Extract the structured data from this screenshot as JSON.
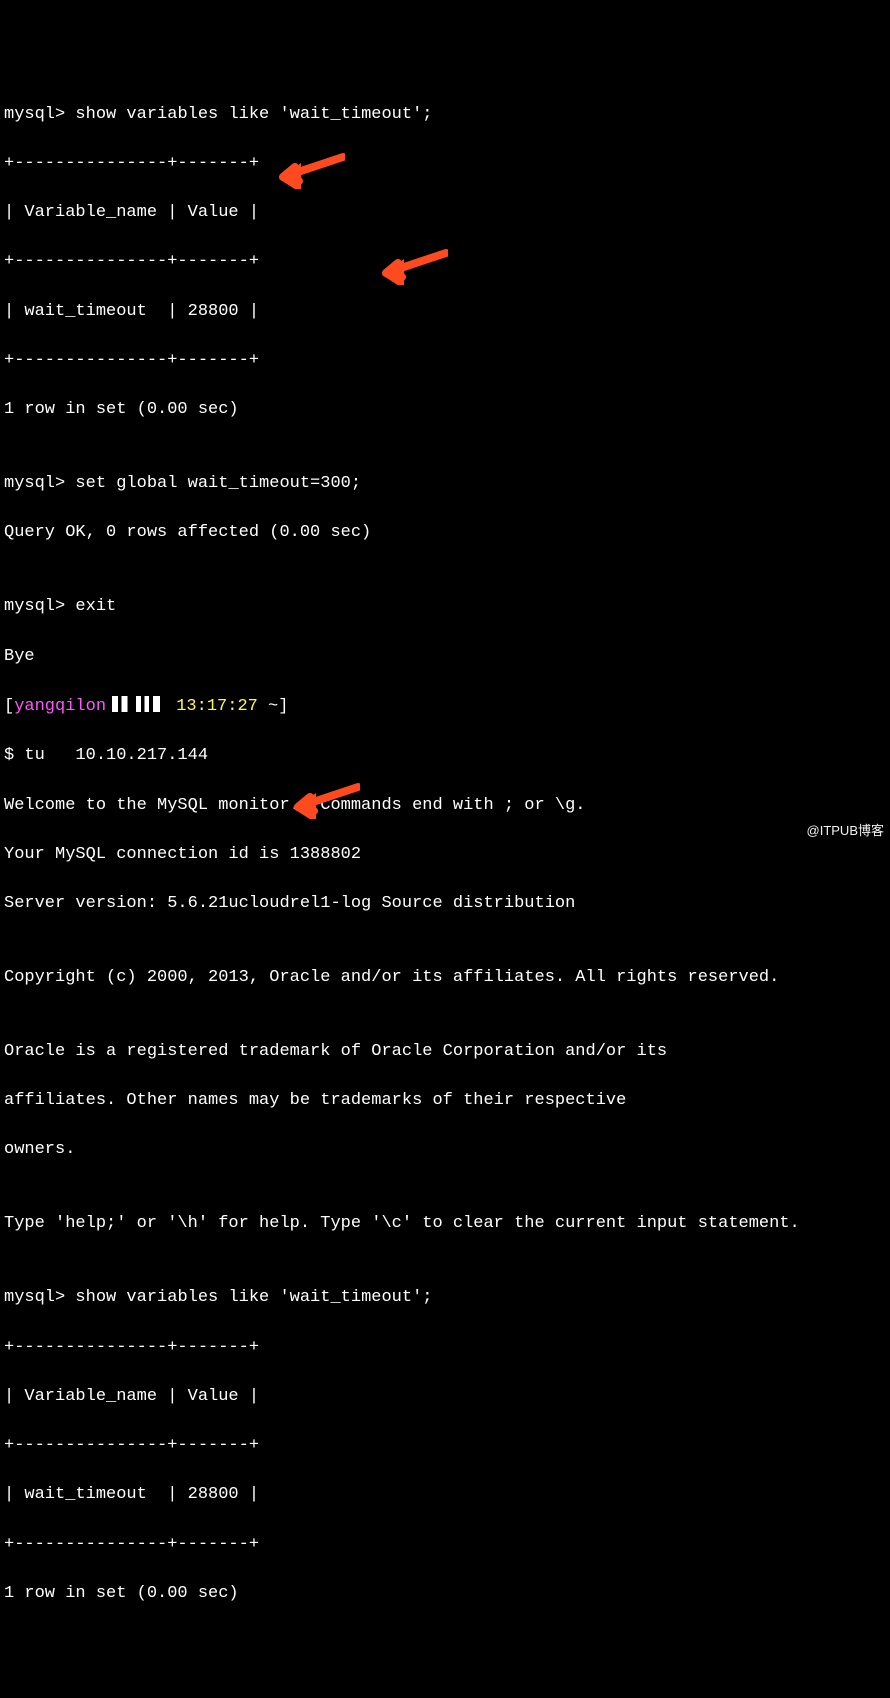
{
  "term": {
    "prompt1": "mysql> ",
    "cmd1": "show variables like 'wait_timeout';",
    "tbl_border_top1": "+---------------+-------+",
    "tbl_header1": "| Variable_name | Value |",
    "tbl_border_mid1": "+---------------+-------+",
    "tbl_row1": "| wait_timeout  | 28800 |",
    "tbl_border_bot1": "+---------------+-------+",
    "result1": "1 row in set (0.00 sec)",
    "blank": "",
    "prompt2": "mysql> ",
    "cmd2": "set global wait_timeout=300;",
    "result2": "Query OK, 0 rows affected (0.00 sec)",
    "prompt3": "mysql> ",
    "cmd3": "exit",
    "bye": "Bye",
    "shell_prefix_open": "[",
    "shell_user": "yangqilon",
    "shell_time": " 13:17:27",
    "shell_tilde": " ~",
    "shell_prefix_close": "]",
    "shell_prompt": "$ tu   10.10.217.144",
    "welcome1": "Welcome to the MySQL monitor.  Commands end with ; or \\g.",
    "welcome2": "Your MySQL connection id is 1388802",
    "welcome3": "Server version: 5.6.21ucloudrel1-log Source distribution",
    "copyright": "Copyright (c) 2000, 2013, Oracle and/or its affiliates. All rights reserved.",
    "trademark1": "Oracle is a registered trademark of Oracle Corporation and/or its",
    "trademark2": "affiliates. Other names may be trademarks of their respective",
    "trademark3": "owners.",
    "help": "Type 'help;' or '\\h' for help. Type '\\c' to clear the current input statement.",
    "prompt4": "mysql> ",
    "cmd4": "show variables like 'wait_timeout';",
    "tbl_border_top2": "+---------------+-------+",
    "tbl_header2": "| Variable_name | Value |",
    "tbl_border_mid2": "+---------------+-------+",
    "tbl_row2": "| wait_timeout  | 28800 |",
    "tbl_border_bot2": "+---------------+-------+",
    "result3": "1 row in set (0.00 sec)"
  },
  "watermark": "@ITPUB博客"
}
